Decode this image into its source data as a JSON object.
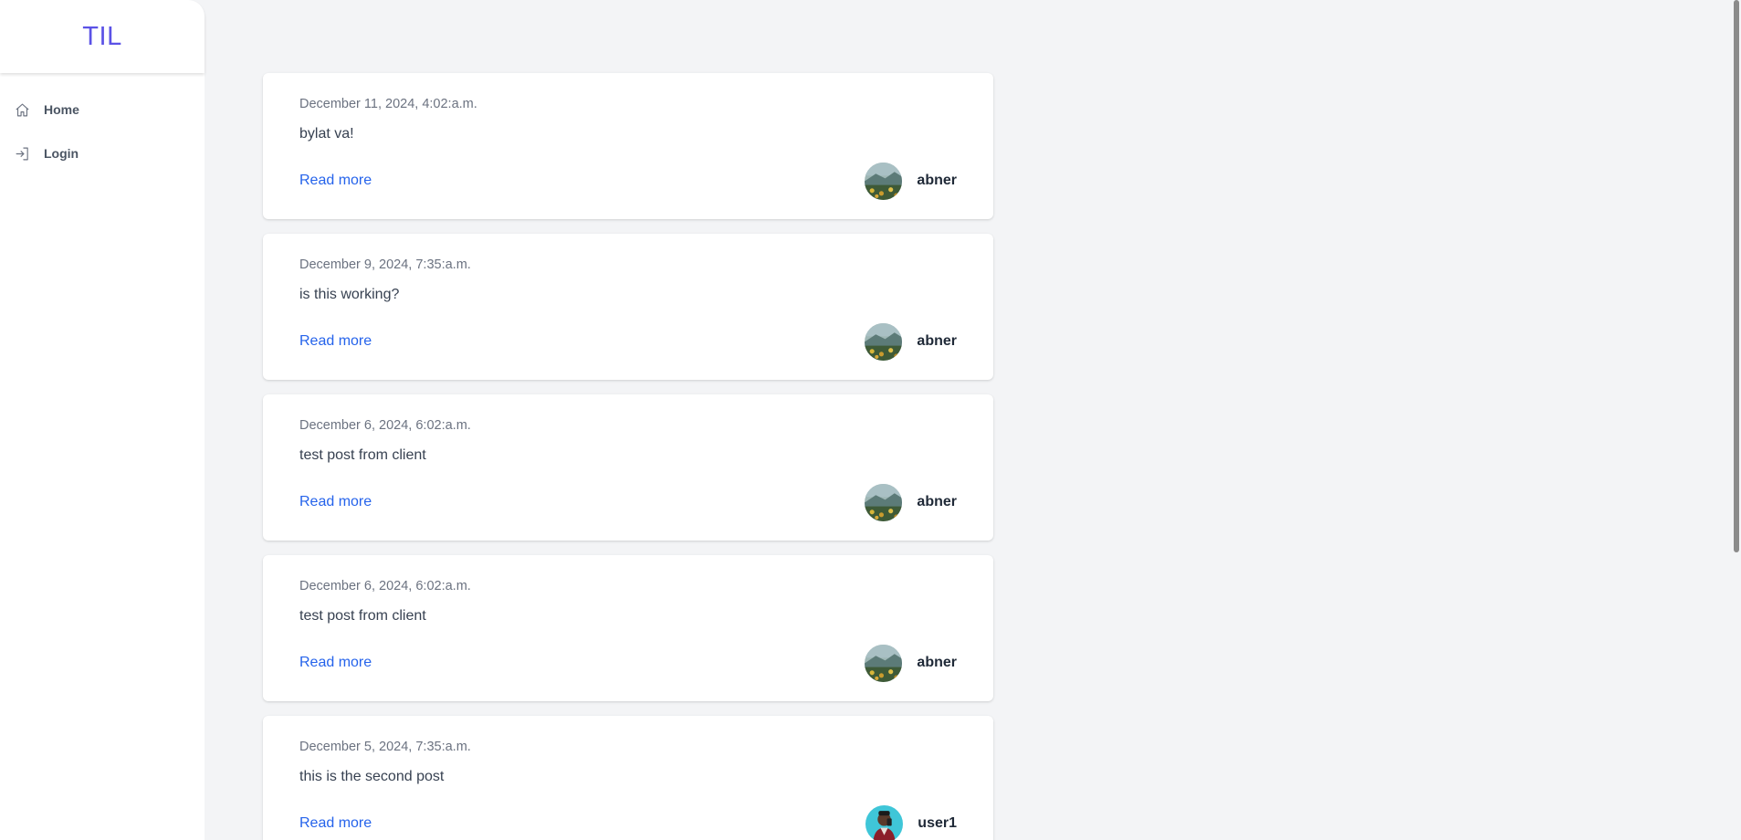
{
  "sidebar": {
    "logo": "TIL",
    "items": [
      {
        "label": "Home",
        "icon": "home-icon"
      },
      {
        "label": "Login",
        "icon": "login-icon"
      }
    ]
  },
  "posts": [
    {
      "date": "December 11, 2024, 4:02:a.m.",
      "text": "bylat va!",
      "read_more": "Read more",
      "author": "abner",
      "avatar": "landscape-avatar"
    },
    {
      "date": "December 9, 2024, 7:35:a.m.",
      "text": "is this working?",
      "read_more": "Read more",
      "author": "abner",
      "avatar": "landscape-avatar"
    },
    {
      "date": "December 6, 2024, 6:02:a.m.",
      "text": "test post from client",
      "read_more": "Read more",
      "author": "abner",
      "avatar": "landscape-avatar"
    },
    {
      "date": "December 6, 2024, 6:02:a.m.",
      "text": "test post from client",
      "read_more": "Read more",
      "author": "abner",
      "avatar": "landscape-avatar"
    },
    {
      "date": "December 5, 2024, 7:35:a.m.",
      "text": "this is the second post",
      "read_more": "Read more",
      "author": "user1",
      "avatar": "person-avatar"
    }
  ],
  "colors": {
    "brand": "#5b52e6",
    "link": "#2563eb",
    "background": "#f3f4f6"
  }
}
